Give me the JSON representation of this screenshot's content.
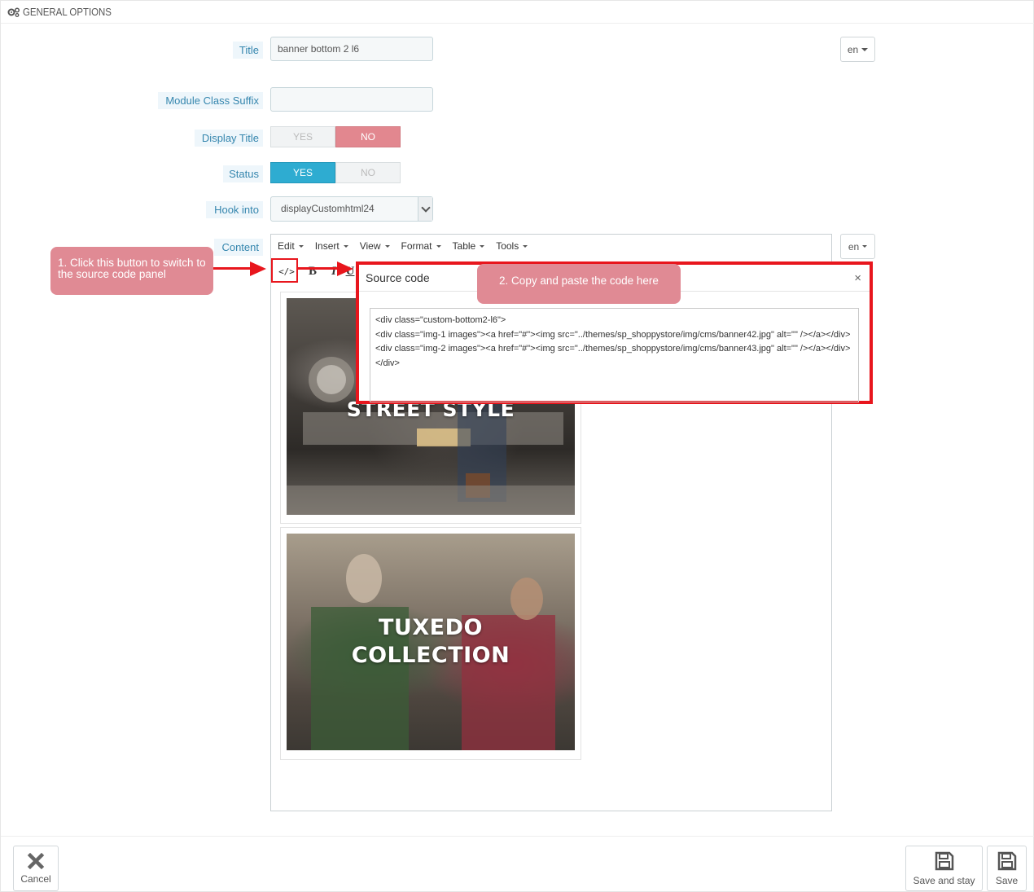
{
  "panel": {
    "heading": "GENERAL OPTIONS"
  },
  "form": {
    "title": {
      "label": "Title",
      "value": "banner bottom 2 l6",
      "lang": "en"
    },
    "module_class_suffix": {
      "label": "Module Class Suffix",
      "value": ""
    },
    "display_title": {
      "label": "Display Title",
      "yes": "YES",
      "no": "NO",
      "selected": "NO"
    },
    "status": {
      "label": "Status",
      "yes": "YES",
      "no": "NO",
      "selected": "YES"
    },
    "hook_into": {
      "label": "Hook into",
      "value": "displayCustomhtml24"
    },
    "content": {
      "label": "Content",
      "lang": "en"
    }
  },
  "editor": {
    "menu": [
      "Edit",
      "Insert",
      "View",
      "Format",
      "Table",
      "Tools"
    ],
    "toolbar": {
      "source_code": "</>",
      "bold": "B",
      "italic": "I",
      "underline": "U"
    },
    "images": [
      {
        "text": "STREET STYLE"
      },
      {
        "line1": "TUXEDO",
        "line2": "COLLECTION"
      }
    ]
  },
  "source_dialog": {
    "title": "Source code",
    "close": "×",
    "code": "<div class=\"custom-bottom2-l6\">\n<div class=\"img-1 images\"><a href=\"#\"><img src=\"../themes/sp_shoppystore/img/cms/banner42.jpg\" alt=\"\" /></a></div>\n<div class=\"img-2 images\"><a href=\"#\"><img src=\"../themes/sp_shoppystore/img/cms/banner43.jpg\" alt=\"\" /></a></div>\n</div>"
  },
  "annotations": {
    "step1": "1. Click this button to switch to the source code panel",
    "step2": "2. Copy and paste the code here"
  },
  "footer": {
    "cancel": "Cancel",
    "save_and_stay": "Save and stay",
    "save": "Save"
  },
  "colors": {
    "accent": "#2eacd1",
    "no_active": "#e2878f",
    "annotation_red": "#e8161d",
    "callout": "#e08a94",
    "label_text": "#3586ae"
  }
}
